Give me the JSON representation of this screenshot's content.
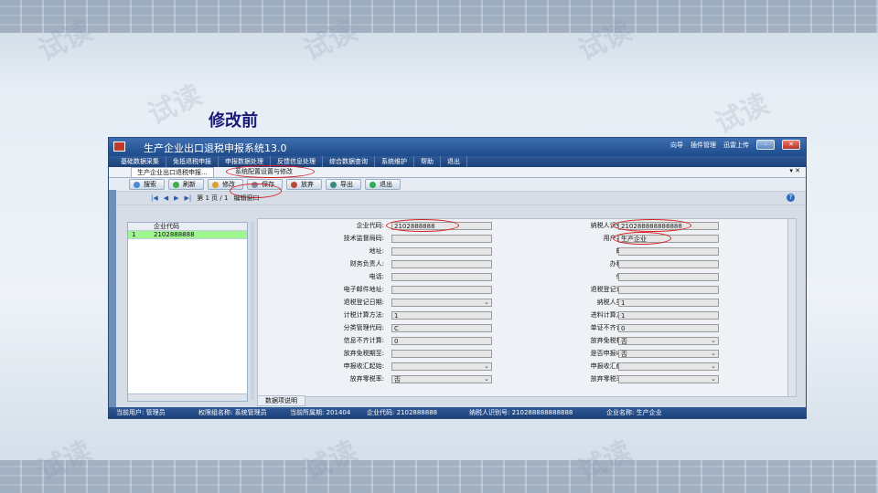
{
  "slide": {
    "title": "修改前"
  },
  "watermark": "试读",
  "window": {
    "title": "生产企业出口退税申报系统13.0",
    "top_right": {
      "nav": "向导",
      "plugin": "插件管理",
      "upload": "迅雷上传"
    },
    "menu": [
      "基础数据采集",
      "免抵退税申报",
      "申报数据处理",
      "反馈信息处理",
      "综合数据查询",
      "系统维护",
      "帮助",
      "退出"
    ],
    "tabs": {
      "breadcrumb": "生产企业出口退税申报...",
      "active": "系统配置设置与修改",
      "controls": "▾ ✕"
    },
    "toolbar": [
      "搜索",
      "刷新",
      "修改",
      "保存",
      "放弃",
      "导出",
      "退出"
    ],
    "nav": {
      "page_text": "第 1 页 / 1",
      "edit_window": "编辑窗口"
    },
    "tree": {
      "header": "企业代码",
      "row_index": "1",
      "row_value": "2102888888"
    },
    "form_left": [
      {
        "label": "企业代码:",
        "value": "2102888888",
        "select": false
      },
      {
        "label": "技术监督局码:",
        "value": "",
        "select": false
      },
      {
        "label": "地址:",
        "value": "",
        "select": false
      },
      {
        "label": "财务负责人:",
        "value": "",
        "select": false
      },
      {
        "label": "电话:",
        "value": "",
        "select": false
      },
      {
        "label": "电子邮件地址:",
        "value": "",
        "select": false
      },
      {
        "label": "退税登记日期:",
        "value": "",
        "select": true
      },
      {
        "label": "计税计算方法:",
        "value": "1",
        "select": false
      },
      {
        "label": "分类管理代码:",
        "value": "C",
        "select": false
      },
      {
        "label": "信息不齐计算:",
        "value": "0",
        "select": false
      },
      {
        "label": "放弃免税期至:",
        "value": "",
        "select": false
      },
      {
        "label": "申报收汇起始:",
        "value": "",
        "select": true
      },
      {
        "label": "放弃零税率:",
        "value": "否",
        "select": true
      }
    ],
    "form_right": [
      {
        "label": "纳税人识别号:",
        "value": "210288888888888",
        "select": false
      },
      {
        "label": "用户名称:",
        "value": "生产企业",
        "select": false
      },
      {
        "label": "邮编:",
        "value": "",
        "select": false
      },
      {
        "label": "办税员:",
        "value": "",
        "select": false
      },
      {
        "label": "传真:",
        "value": "",
        "select": false
      },
      {
        "label": "退税登记证号:",
        "value": "",
        "select": false
      },
      {
        "label": "纳税人类别:",
        "value": "1",
        "select": false
      },
      {
        "label": "进料计算方法:",
        "value": "1",
        "select": false
      },
      {
        "label": "单证不齐计算:",
        "value": "0",
        "select": false
      },
      {
        "label": "放弃免税标志:",
        "value": "否",
        "select": true
      },
      {
        "label": "是否申报收汇:",
        "value": "否",
        "select": true
      },
      {
        "label": "申报收汇截止:",
        "value": "",
        "select": true
      },
      {
        "label": "放弃零税率起:",
        "value": "",
        "select": true
      }
    ],
    "bottom_tab": "数据项说明",
    "status": {
      "user": "当前用户: 管理员",
      "group": "权限组名称: 系统管理员",
      "period": "当前所属期: 201404",
      "company_code": "企业代码: 2102888888",
      "taxpayer_id": "纳税人识别号: 210288888888888",
      "company_name": "企业名称: 生产企业"
    }
  },
  "colors": {
    "title_bar": "#1d4b8c",
    "highlight": "#d62020",
    "tree_selected": "#9ff58f"
  }
}
